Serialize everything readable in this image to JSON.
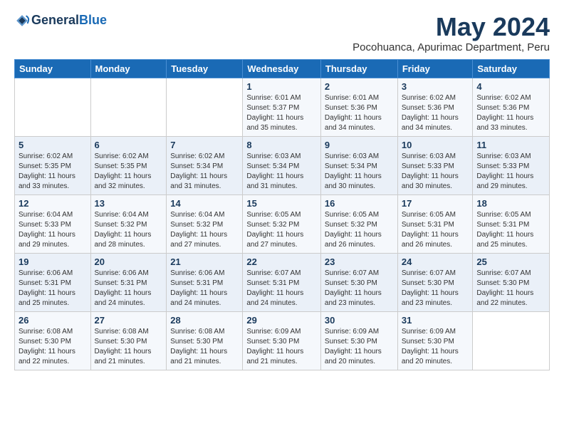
{
  "header": {
    "logo_line1": "General",
    "logo_line2": "Blue",
    "title": "May 2024",
    "subtitle": "Pocohuanca, Apurimac Department, Peru"
  },
  "weekdays": [
    "Sunday",
    "Monday",
    "Tuesday",
    "Wednesday",
    "Thursday",
    "Friday",
    "Saturday"
  ],
  "weeks": [
    [
      {
        "day": "",
        "info": ""
      },
      {
        "day": "",
        "info": ""
      },
      {
        "day": "",
        "info": ""
      },
      {
        "day": "1",
        "info": "Sunrise: 6:01 AM\nSunset: 5:37 PM\nDaylight: 11 hours and 35 minutes."
      },
      {
        "day": "2",
        "info": "Sunrise: 6:01 AM\nSunset: 5:36 PM\nDaylight: 11 hours and 34 minutes."
      },
      {
        "day": "3",
        "info": "Sunrise: 6:02 AM\nSunset: 5:36 PM\nDaylight: 11 hours and 34 minutes."
      },
      {
        "day": "4",
        "info": "Sunrise: 6:02 AM\nSunset: 5:36 PM\nDaylight: 11 hours and 33 minutes."
      }
    ],
    [
      {
        "day": "5",
        "info": "Sunrise: 6:02 AM\nSunset: 5:35 PM\nDaylight: 11 hours and 33 minutes."
      },
      {
        "day": "6",
        "info": "Sunrise: 6:02 AM\nSunset: 5:35 PM\nDaylight: 11 hours and 32 minutes."
      },
      {
        "day": "7",
        "info": "Sunrise: 6:02 AM\nSunset: 5:34 PM\nDaylight: 11 hours and 31 minutes."
      },
      {
        "day": "8",
        "info": "Sunrise: 6:03 AM\nSunset: 5:34 PM\nDaylight: 11 hours and 31 minutes."
      },
      {
        "day": "9",
        "info": "Sunrise: 6:03 AM\nSunset: 5:34 PM\nDaylight: 11 hours and 30 minutes."
      },
      {
        "day": "10",
        "info": "Sunrise: 6:03 AM\nSunset: 5:33 PM\nDaylight: 11 hours and 30 minutes."
      },
      {
        "day": "11",
        "info": "Sunrise: 6:03 AM\nSunset: 5:33 PM\nDaylight: 11 hours and 29 minutes."
      }
    ],
    [
      {
        "day": "12",
        "info": "Sunrise: 6:04 AM\nSunset: 5:33 PM\nDaylight: 11 hours and 29 minutes."
      },
      {
        "day": "13",
        "info": "Sunrise: 6:04 AM\nSunset: 5:32 PM\nDaylight: 11 hours and 28 minutes."
      },
      {
        "day": "14",
        "info": "Sunrise: 6:04 AM\nSunset: 5:32 PM\nDaylight: 11 hours and 27 minutes."
      },
      {
        "day": "15",
        "info": "Sunrise: 6:05 AM\nSunset: 5:32 PM\nDaylight: 11 hours and 27 minutes."
      },
      {
        "day": "16",
        "info": "Sunrise: 6:05 AM\nSunset: 5:32 PM\nDaylight: 11 hours and 26 minutes."
      },
      {
        "day": "17",
        "info": "Sunrise: 6:05 AM\nSunset: 5:31 PM\nDaylight: 11 hours and 26 minutes."
      },
      {
        "day": "18",
        "info": "Sunrise: 6:05 AM\nSunset: 5:31 PM\nDaylight: 11 hours and 25 minutes."
      }
    ],
    [
      {
        "day": "19",
        "info": "Sunrise: 6:06 AM\nSunset: 5:31 PM\nDaylight: 11 hours and 25 minutes."
      },
      {
        "day": "20",
        "info": "Sunrise: 6:06 AM\nSunset: 5:31 PM\nDaylight: 11 hours and 24 minutes."
      },
      {
        "day": "21",
        "info": "Sunrise: 6:06 AM\nSunset: 5:31 PM\nDaylight: 11 hours and 24 minutes."
      },
      {
        "day": "22",
        "info": "Sunrise: 6:07 AM\nSunset: 5:31 PM\nDaylight: 11 hours and 24 minutes."
      },
      {
        "day": "23",
        "info": "Sunrise: 6:07 AM\nSunset: 5:30 PM\nDaylight: 11 hours and 23 minutes."
      },
      {
        "day": "24",
        "info": "Sunrise: 6:07 AM\nSunset: 5:30 PM\nDaylight: 11 hours and 23 minutes."
      },
      {
        "day": "25",
        "info": "Sunrise: 6:07 AM\nSunset: 5:30 PM\nDaylight: 11 hours and 22 minutes."
      }
    ],
    [
      {
        "day": "26",
        "info": "Sunrise: 6:08 AM\nSunset: 5:30 PM\nDaylight: 11 hours and 22 minutes."
      },
      {
        "day": "27",
        "info": "Sunrise: 6:08 AM\nSunset: 5:30 PM\nDaylight: 11 hours and 21 minutes."
      },
      {
        "day": "28",
        "info": "Sunrise: 6:08 AM\nSunset: 5:30 PM\nDaylight: 11 hours and 21 minutes."
      },
      {
        "day": "29",
        "info": "Sunrise: 6:09 AM\nSunset: 5:30 PM\nDaylight: 11 hours and 21 minutes."
      },
      {
        "day": "30",
        "info": "Sunrise: 6:09 AM\nSunset: 5:30 PM\nDaylight: 11 hours and 20 minutes."
      },
      {
        "day": "31",
        "info": "Sunrise: 6:09 AM\nSunset: 5:30 PM\nDaylight: 11 hours and 20 minutes."
      },
      {
        "day": "",
        "info": ""
      }
    ]
  ]
}
